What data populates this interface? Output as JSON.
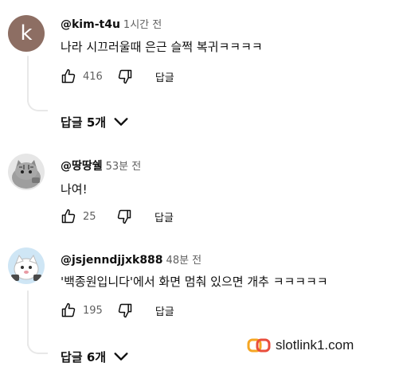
{
  "comments": [
    {
      "author": "@kim-t4u",
      "time": "1시간 전",
      "avatar_letter": "k",
      "text": "나라 시끄러울때 은근 슬쩍 복귀ㅋㅋㅋㅋ",
      "likes": "416",
      "reply_label": "답글",
      "replies_label": "답글 5개"
    },
    {
      "author": "@땅땅쉘",
      "time": "53분 전",
      "text": "나여!",
      "likes": "25",
      "reply_label": "답글"
    },
    {
      "author": "@jsjenndjjxk888",
      "time": "48분 전",
      "text": "'백종원입니다'에서 화면 멈춰 있으면 개추 ㅋㅋㅋㅋㅋ",
      "likes": "195",
      "reply_label": "답글",
      "replies_label": "답글 6개"
    }
  ],
  "watermark": {
    "text": "slotlink1.com"
  },
  "colors": {
    "avatar_k": "#8d6e63",
    "secondary_text": "#606060",
    "watermark_orange": "#f5a623",
    "watermark_red": "#e94e3c"
  }
}
